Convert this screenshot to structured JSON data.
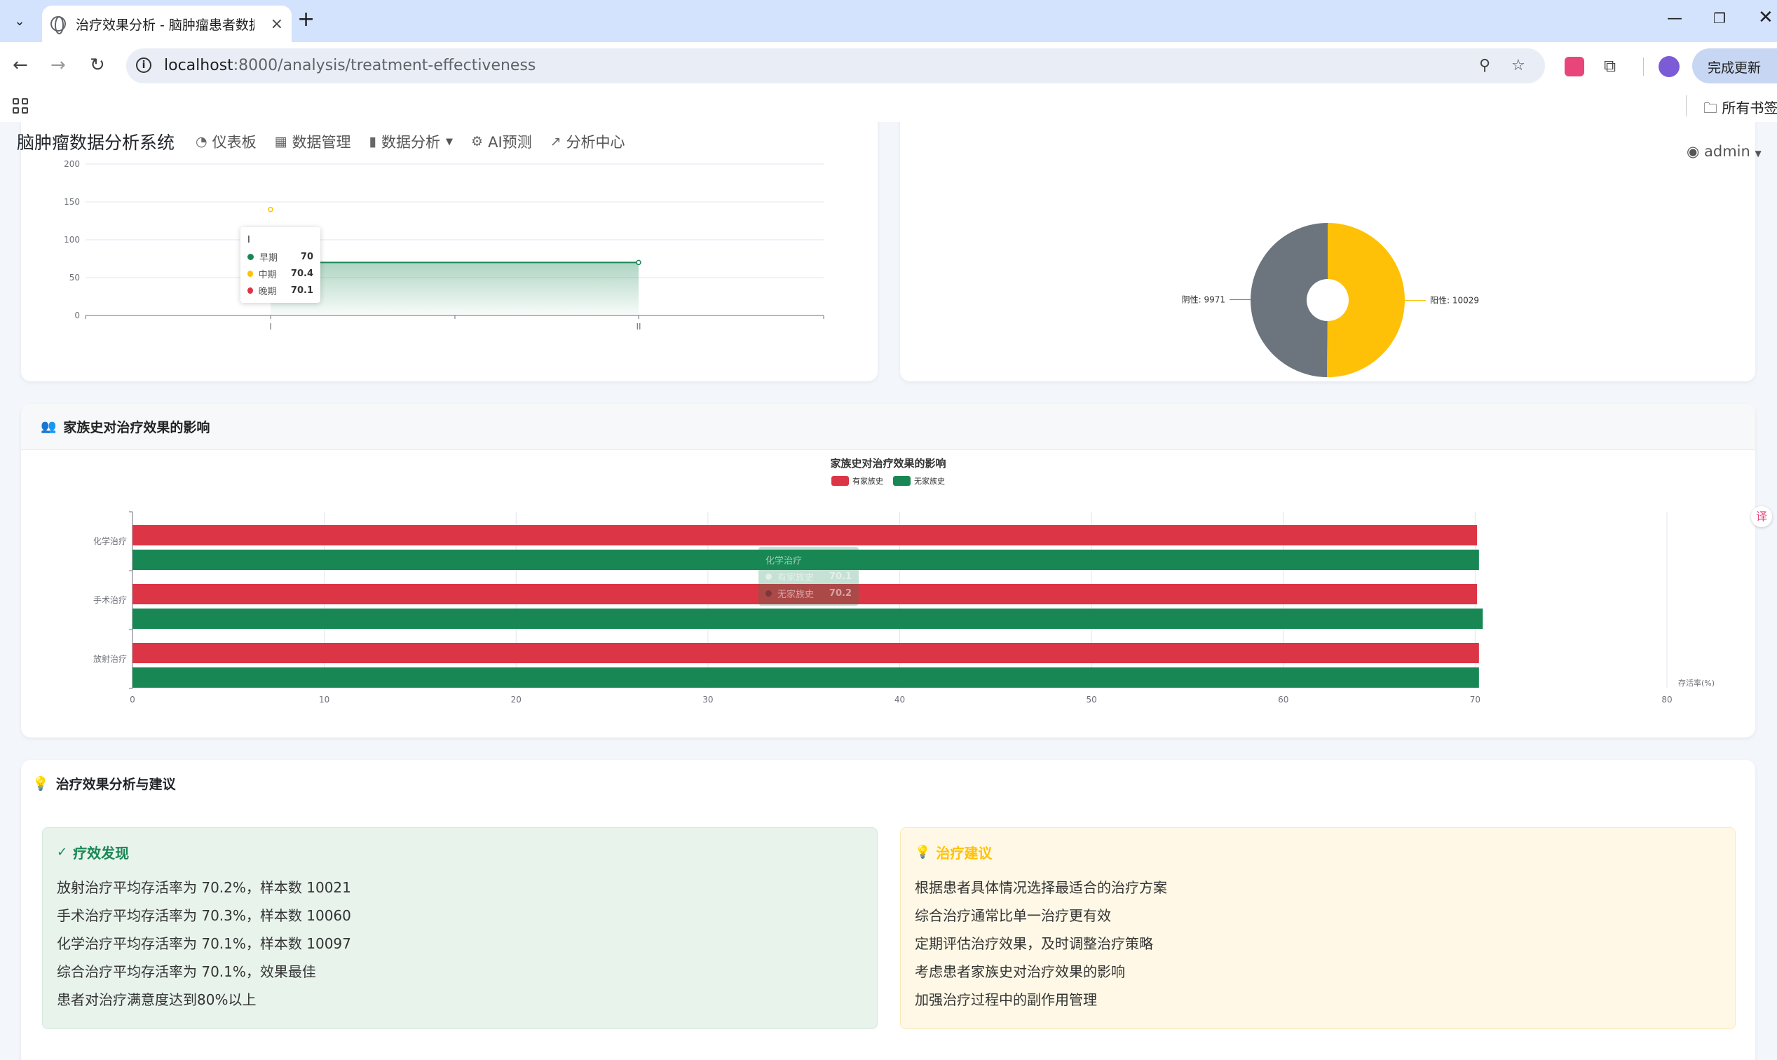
{
  "browser": {
    "tab_title": "治疗效果分析 - 脑肿瘤患者数据",
    "url_host": "localhost",
    "url_rest": ":8000/analysis/treatment-effectiveness",
    "update_label": "完成更新",
    "bookmarks_all": "所有书签"
  },
  "navbar": {
    "brand": "脑肿瘤数据分析系统",
    "items": [
      {
        "icon": "dashboard-icon",
        "label": "仪表板"
      },
      {
        "icon": "table-icon",
        "label": "数据管理"
      },
      {
        "icon": "bar-chart-icon",
        "label": "数据分析"
      },
      {
        "icon": "robot-icon",
        "label": "AI预测"
      },
      {
        "icon": "line-chart-icon",
        "label": "分析中心"
      }
    ],
    "user": "admin"
  },
  "family_card": {
    "title": "家族史对治疗效果的影响"
  },
  "tooltip_stage": {
    "header": "I",
    "rows": [
      {
        "name": "早期",
        "value": "70",
        "color": "#198754"
      },
      {
        "name": "中期",
        "value": "70.4",
        "color": "#ffc107"
      },
      {
        "name": "晚期",
        "value": "70.1",
        "color": "#dc3545"
      }
    ]
  },
  "tooltip_family": {
    "header": "化学治疗",
    "rows": [
      {
        "name": "有家族史",
        "value": "70.1"
      },
      {
        "name": "无家族史",
        "value": "70.2"
      }
    ]
  },
  "analysis": {
    "title": "治疗效果分析与建议",
    "findings_title": "疗效发现",
    "findings": [
      "放射治疗平均存活率为 70.2%，样本数 10021",
      "手术治疗平均存活率为 70.3%，样本数 10060",
      "化学治疗平均存活率为 70.1%，样本数 10097",
      "综合治疗平均存活率为 70.1%，效果最佳",
      "患者对治疗满意度达到80%以上"
    ],
    "advice_title": "治疗建议",
    "advice": [
      "根据患者具体情况选择最适合的治疗方案",
      "综合治疗通常比单一治疗更有效",
      "定期评估治疗效果，及时调整治疗策略",
      "考虑患者家族史对治疗效果的影响",
      "加强治疗过程中的副作用管理"
    ]
  },
  "chart_data": [
    {
      "type": "line",
      "title": "",
      "categories": [
        "I",
        "II"
      ],
      "series": [
        {
          "name": "早期",
          "values": [
            70,
            70
          ],
          "color": "#198754"
        },
        {
          "name": "中期",
          "values": [
            140,
            null
          ],
          "color": "#ffc107"
        }
      ],
      "ylim": [
        0,
        200
      ],
      "yticks": [
        0,
        50,
        100,
        150,
        200
      ],
      "area": true
    },
    {
      "type": "pie",
      "title": "",
      "slices": [
        {
          "name": "阴性",
          "label": "阴性: 9971",
          "value": 9971,
          "color": "#6c757d"
        },
        {
          "name": "阳性",
          "label": "阳性: 10029",
          "value": 10029,
          "color": "#ffc107"
        }
      ],
      "donut": true
    },
    {
      "type": "bar",
      "orientation": "horizontal",
      "title": "家族史对治疗效果的影响",
      "categories": [
        "化学治疗",
        "手术治疗",
        "放射治疗"
      ],
      "series": [
        {
          "name": "有家族史",
          "values": [
            70.1,
            70.1,
            70.2
          ],
          "color": "#dc3545"
        },
        {
          "name": "无家族史",
          "values": [
            70.2,
            70.4,
            70.2
          ],
          "color": "#198754"
        }
      ],
      "xlim": [
        0,
        80
      ],
      "xticks": [
        0,
        10,
        20,
        30,
        40,
        50,
        60,
        70,
        80
      ],
      "xlabel": "存活率(%)",
      "legend": "top-center"
    }
  ]
}
